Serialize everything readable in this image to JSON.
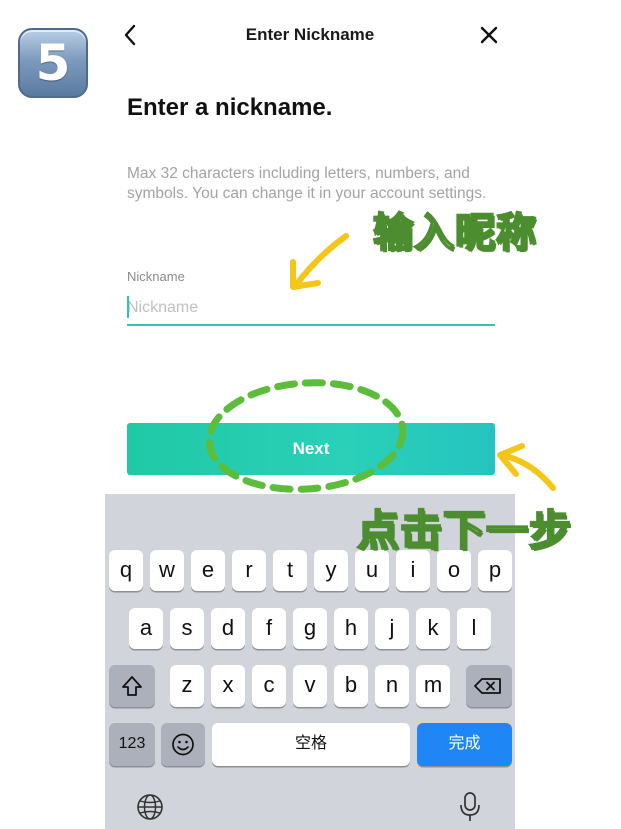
{
  "badge": {
    "number": "5"
  },
  "nav": {
    "title": "Enter Nickname",
    "back_icon": "chevron-left-icon",
    "close_icon": "close-icon"
  },
  "main": {
    "heading": "Enter a nickname.",
    "helper_text": "Max 32 characters including letters, numbers, and symbols. You can change it in your account settings.",
    "field": {
      "label": "Nickname",
      "placeholder": "Nickname",
      "value": ""
    },
    "next_label": "Next"
  },
  "annotations": {
    "enter_nickname": "输入昵称",
    "tap_next": "点击下一步"
  },
  "keyboard": {
    "row1": [
      "q",
      "w",
      "e",
      "r",
      "t",
      "y",
      "u",
      "i",
      "o",
      "p"
    ],
    "row2": [
      "a",
      "s",
      "d",
      "f",
      "g",
      "h",
      "j",
      "k",
      "l"
    ],
    "row3": [
      "z",
      "x",
      "c",
      "v",
      "b",
      "n",
      "m"
    ],
    "numbers_label": "123",
    "space_label": "空格",
    "done_label": "完成",
    "icons": {
      "shift": "shift-icon",
      "delete": "backspace-icon",
      "emoji": "emoji-icon",
      "globe": "globe-icon",
      "mic": "microphone-icon"
    }
  },
  "colors": {
    "accent": "#2ec4b3",
    "button_start": "#20c9a6",
    "button_end": "#25c4c0",
    "done_key": "#1f87f5",
    "annotation_fill": "#e8f3a8",
    "annotation_stroke": "#4b8d2f",
    "arrow": "#f5c518",
    "dashed_circle": "#5cbd3b"
  }
}
